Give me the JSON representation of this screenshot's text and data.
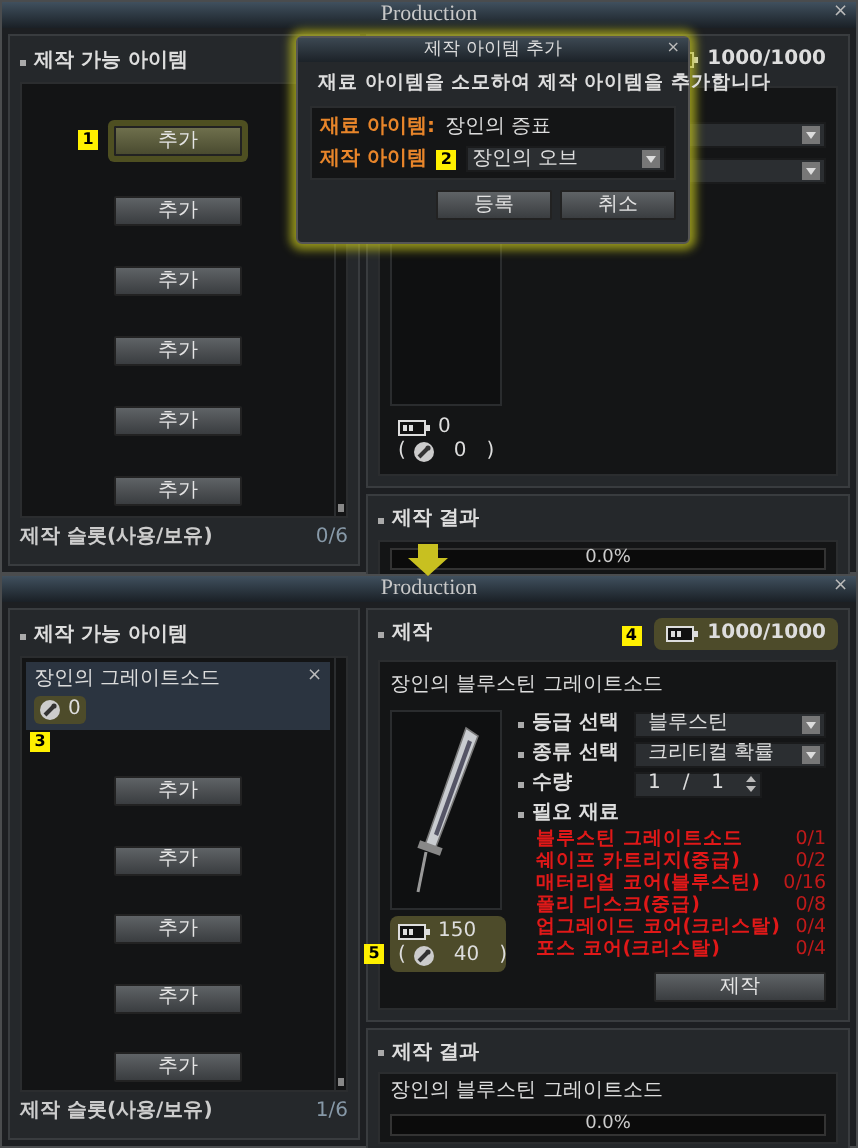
{
  "top_window": {
    "title": "Production",
    "close": "×",
    "slots": {
      "heading": "제작 가능 아이템",
      "add_buttons": [
        {
          "label": "추가",
          "highlighted": true,
          "marker": "1"
        },
        {
          "label": "추가",
          "highlighted": false
        },
        {
          "label": "추가",
          "highlighted": false
        },
        {
          "label": "추가",
          "highlighted": false
        },
        {
          "label": "추가",
          "highlighted": false
        },
        {
          "label": "추가",
          "highlighted": false
        }
      ],
      "footer_label": "제작 슬롯(사용/보유)",
      "footer_count": "0/6"
    },
    "craft": {
      "energy": {
        "value": "1000/1000"
      },
      "cost": {
        "energy": "0",
        "paren_open": "(",
        "parts": "0",
        "paren_close": ")"
      }
    },
    "result": {
      "heading": "제작 결과",
      "progress": {
        "text": "0.0%",
        "level": 0
      }
    },
    "dialog": {
      "title": "제작 아이템 추가",
      "close": "×",
      "description": "재료 아이템을 소모하여 제작 아이템을 추가합니다",
      "material_label": "재료 아이템:",
      "material_value": "장인의 증표",
      "target_label": "제작 아이템",
      "marker": "2",
      "target_value": "장인의 오브",
      "buttons": [
        "등록",
        "취소"
      ]
    }
  },
  "bottom_window": {
    "title": "Production",
    "close": "×",
    "slots": {
      "heading": "제작 가능 아이템",
      "items": [
        {
          "name": "장인의 그레이트소드",
          "close": "×",
          "count": "0",
          "highlighted": true,
          "marker": "3"
        }
      ],
      "add_buttons": [
        {
          "label": "추가",
          "highlighted": false
        },
        {
          "label": "추가",
          "highlighted": false
        },
        {
          "label": "추가",
          "highlighted": false
        },
        {
          "label": "추가",
          "highlighted": false
        },
        {
          "label": "추가",
          "highlighted": false
        }
      ],
      "footer_label": "제작 슬롯(사용/보유)",
      "footer_count": "1/6"
    },
    "craft": {
      "heading": "제작",
      "energy": {
        "value": "1000/1000",
        "highlighted": true,
        "marker": "4"
      },
      "item_name": "장인의 블루스틴 그레이트소드",
      "options": [
        {
          "kind": "select",
          "label": "등급 선택",
          "value": "블루스틴"
        },
        {
          "kind": "select",
          "label": "종류 선택",
          "value": "크리티컬 확률"
        },
        {
          "kind": "stepper",
          "label": "수량",
          "value": "1",
          "separator": "/",
          "max": "1"
        }
      ],
      "materials_heading": "필요 재료",
      "materials": [
        {
          "name": "블루스틴 그레이트소드",
          "count": "0/1"
        },
        {
          "name": "쉐이프 카트리지(중급)",
          "count": "0/2"
        },
        {
          "name": "매터리얼 코어(블루스틴)",
          "count": "0/16"
        },
        {
          "name": "폴리 디스크(중급)",
          "count": "0/8"
        },
        {
          "name": "업그레이드 코어(크리스탈)",
          "count": "0/4"
        },
        {
          "name": "포스 코어(크리스탈)",
          "count": "0/4"
        }
      ],
      "cost": {
        "energy": "150",
        "paren_open": "(",
        "parts": "40",
        "paren_close": ")",
        "highlighted": true,
        "marker": "5"
      },
      "craft_button": "제작"
    },
    "result": {
      "heading": "제작 결과",
      "item_name": "장인의 블루스틴 그레이트소드",
      "progress": {
        "text": "0.0%",
        "level": 0
      }
    }
  }
}
